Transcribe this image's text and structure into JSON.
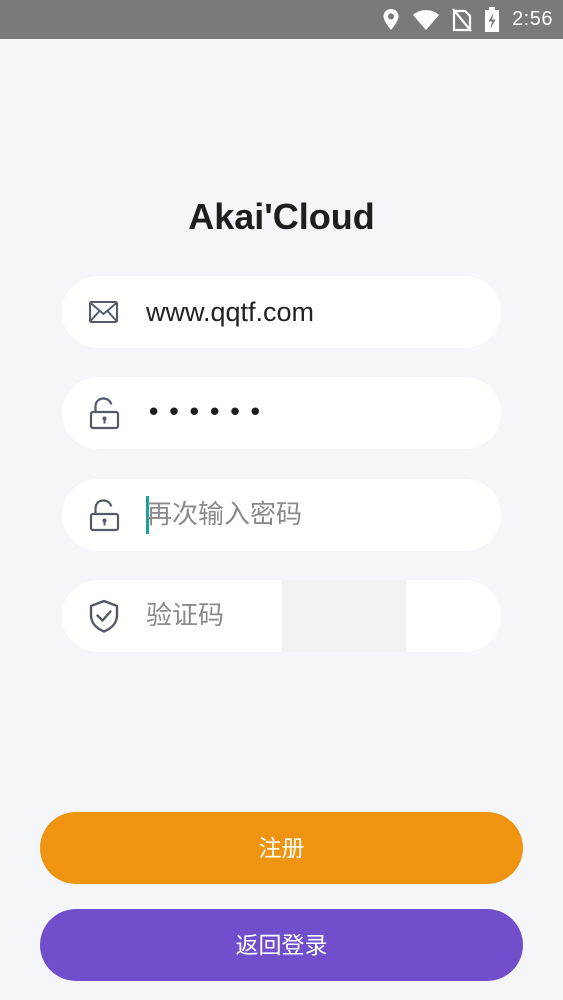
{
  "status_bar": {
    "time": "2:56",
    "icons": [
      "location-icon",
      "wifi-icon",
      "no-sim-icon",
      "battery-charging-icon"
    ]
  },
  "app": {
    "title": "Akai'Cloud"
  },
  "form": {
    "email": {
      "icon": "mail-icon",
      "value": "www.qqtf.com"
    },
    "password": {
      "icon": "lock-icon",
      "masked_value": "••••••"
    },
    "confirm_password": {
      "icon": "lock-icon",
      "placeholder": "再次输入密码"
    },
    "captcha": {
      "icon": "shield-check-icon",
      "placeholder": "验证码"
    }
  },
  "buttons": {
    "register_label": "注册",
    "back_to_login_label": "返回登录"
  },
  "colors": {
    "status_bar": "#7a7a7a",
    "background": "#f5f6f9",
    "register_button": "#ee9411",
    "back_button": "#714ecb",
    "cursor": "#1aa39a",
    "icon": "#555a66"
  }
}
